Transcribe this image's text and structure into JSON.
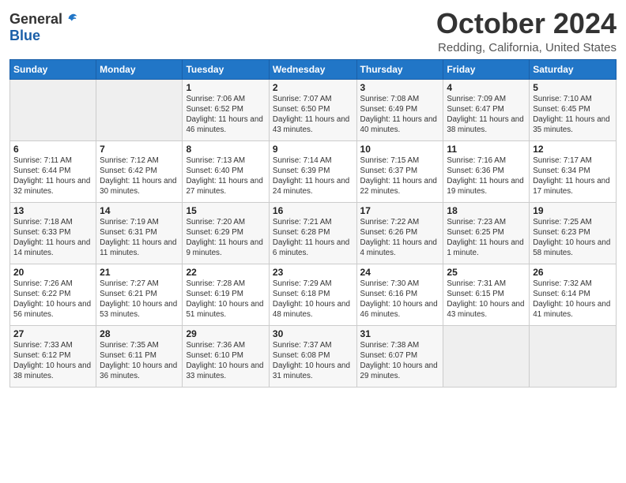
{
  "header": {
    "logo_general": "General",
    "logo_blue": "Blue",
    "month_title": "October 2024",
    "location": "Redding, California, United States"
  },
  "days_of_week": [
    "Sunday",
    "Monday",
    "Tuesday",
    "Wednesday",
    "Thursday",
    "Friday",
    "Saturday"
  ],
  "weeks": [
    [
      {
        "day": "",
        "info": ""
      },
      {
        "day": "",
        "info": ""
      },
      {
        "day": "1",
        "info": "Sunrise: 7:06 AM\nSunset: 6:52 PM\nDaylight: 11 hours and 46 minutes."
      },
      {
        "day": "2",
        "info": "Sunrise: 7:07 AM\nSunset: 6:50 PM\nDaylight: 11 hours and 43 minutes."
      },
      {
        "day": "3",
        "info": "Sunrise: 7:08 AM\nSunset: 6:49 PM\nDaylight: 11 hours and 40 minutes."
      },
      {
        "day": "4",
        "info": "Sunrise: 7:09 AM\nSunset: 6:47 PM\nDaylight: 11 hours and 38 minutes."
      },
      {
        "day": "5",
        "info": "Sunrise: 7:10 AM\nSunset: 6:45 PM\nDaylight: 11 hours and 35 minutes."
      }
    ],
    [
      {
        "day": "6",
        "info": "Sunrise: 7:11 AM\nSunset: 6:44 PM\nDaylight: 11 hours and 32 minutes."
      },
      {
        "day": "7",
        "info": "Sunrise: 7:12 AM\nSunset: 6:42 PM\nDaylight: 11 hours and 30 minutes."
      },
      {
        "day": "8",
        "info": "Sunrise: 7:13 AM\nSunset: 6:40 PM\nDaylight: 11 hours and 27 minutes."
      },
      {
        "day": "9",
        "info": "Sunrise: 7:14 AM\nSunset: 6:39 PM\nDaylight: 11 hours and 24 minutes."
      },
      {
        "day": "10",
        "info": "Sunrise: 7:15 AM\nSunset: 6:37 PM\nDaylight: 11 hours and 22 minutes."
      },
      {
        "day": "11",
        "info": "Sunrise: 7:16 AM\nSunset: 6:36 PM\nDaylight: 11 hours and 19 minutes."
      },
      {
        "day": "12",
        "info": "Sunrise: 7:17 AM\nSunset: 6:34 PM\nDaylight: 11 hours and 17 minutes."
      }
    ],
    [
      {
        "day": "13",
        "info": "Sunrise: 7:18 AM\nSunset: 6:33 PM\nDaylight: 11 hours and 14 minutes."
      },
      {
        "day": "14",
        "info": "Sunrise: 7:19 AM\nSunset: 6:31 PM\nDaylight: 11 hours and 11 minutes."
      },
      {
        "day": "15",
        "info": "Sunrise: 7:20 AM\nSunset: 6:29 PM\nDaylight: 11 hours and 9 minutes."
      },
      {
        "day": "16",
        "info": "Sunrise: 7:21 AM\nSunset: 6:28 PM\nDaylight: 11 hours and 6 minutes."
      },
      {
        "day": "17",
        "info": "Sunrise: 7:22 AM\nSunset: 6:26 PM\nDaylight: 11 hours and 4 minutes."
      },
      {
        "day": "18",
        "info": "Sunrise: 7:23 AM\nSunset: 6:25 PM\nDaylight: 11 hours and 1 minute."
      },
      {
        "day": "19",
        "info": "Sunrise: 7:25 AM\nSunset: 6:23 PM\nDaylight: 10 hours and 58 minutes."
      }
    ],
    [
      {
        "day": "20",
        "info": "Sunrise: 7:26 AM\nSunset: 6:22 PM\nDaylight: 10 hours and 56 minutes."
      },
      {
        "day": "21",
        "info": "Sunrise: 7:27 AM\nSunset: 6:21 PM\nDaylight: 10 hours and 53 minutes."
      },
      {
        "day": "22",
        "info": "Sunrise: 7:28 AM\nSunset: 6:19 PM\nDaylight: 10 hours and 51 minutes."
      },
      {
        "day": "23",
        "info": "Sunrise: 7:29 AM\nSunset: 6:18 PM\nDaylight: 10 hours and 48 minutes."
      },
      {
        "day": "24",
        "info": "Sunrise: 7:30 AM\nSunset: 6:16 PM\nDaylight: 10 hours and 46 minutes."
      },
      {
        "day": "25",
        "info": "Sunrise: 7:31 AM\nSunset: 6:15 PM\nDaylight: 10 hours and 43 minutes."
      },
      {
        "day": "26",
        "info": "Sunrise: 7:32 AM\nSunset: 6:14 PM\nDaylight: 10 hours and 41 minutes."
      }
    ],
    [
      {
        "day": "27",
        "info": "Sunrise: 7:33 AM\nSunset: 6:12 PM\nDaylight: 10 hours and 38 minutes."
      },
      {
        "day": "28",
        "info": "Sunrise: 7:35 AM\nSunset: 6:11 PM\nDaylight: 10 hours and 36 minutes."
      },
      {
        "day": "29",
        "info": "Sunrise: 7:36 AM\nSunset: 6:10 PM\nDaylight: 10 hours and 33 minutes."
      },
      {
        "day": "30",
        "info": "Sunrise: 7:37 AM\nSunset: 6:08 PM\nDaylight: 10 hours and 31 minutes."
      },
      {
        "day": "31",
        "info": "Sunrise: 7:38 AM\nSunset: 6:07 PM\nDaylight: 10 hours and 29 minutes."
      },
      {
        "day": "",
        "info": ""
      },
      {
        "day": "",
        "info": ""
      }
    ]
  ]
}
